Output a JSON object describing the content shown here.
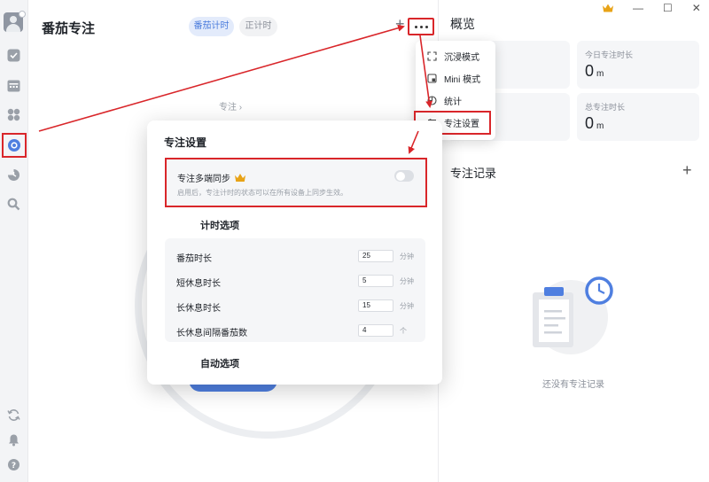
{
  "header": {
    "title": "番茄专注",
    "tab_pomodoro": "番茄计时",
    "tab_stopwatch": "正计时"
  },
  "main": {
    "focus_crumb": "专注 ›"
  },
  "menu": {
    "items": [
      {
        "label": "沉浸模式",
        "icon": "fullscreen-icon"
      },
      {
        "label": "Mini 模式",
        "icon": "mini-window-icon"
      },
      {
        "label": "统计",
        "icon": "pie-chart-icon"
      },
      {
        "label": "专注设置",
        "icon": "sliders-icon"
      }
    ]
  },
  "settings": {
    "title": "专注设置",
    "sync_title": "专注多端同步",
    "sync_desc": "启用后，专注计时的状态可以在所有设备上同步生效。",
    "sync_enabled": false,
    "timer_section": "计时选项",
    "rows": [
      {
        "label": "番茄时长",
        "value": "25",
        "unit": "分钟"
      },
      {
        "label": "短休息时长",
        "value": "5",
        "unit": "分钟"
      },
      {
        "label": "长休息时长",
        "value": "15",
        "unit": "分钟"
      },
      {
        "label": "长休息间隔番茄数",
        "value": "4",
        "unit": "个"
      }
    ],
    "auto_section": "自动选项"
  },
  "overview": {
    "title": "概览",
    "cards": [
      {
        "label": "",
        "value": ""
      },
      {
        "label": "今日专注时长",
        "value": "0",
        "unit": "m"
      },
      {
        "label": "",
        "value": ""
      },
      {
        "label": "总专注时长",
        "value": "0",
        "unit": "m"
      }
    ]
  },
  "records": {
    "title": "专注记录",
    "add": "+",
    "empty": "还没有专注记录"
  },
  "window": {
    "minimize": "—",
    "maximize": "☐",
    "close": "✕"
  },
  "colors": {
    "accent": "#4f7fe0",
    "highlight_red": "#d9262a",
    "crown": "#e8a317"
  }
}
